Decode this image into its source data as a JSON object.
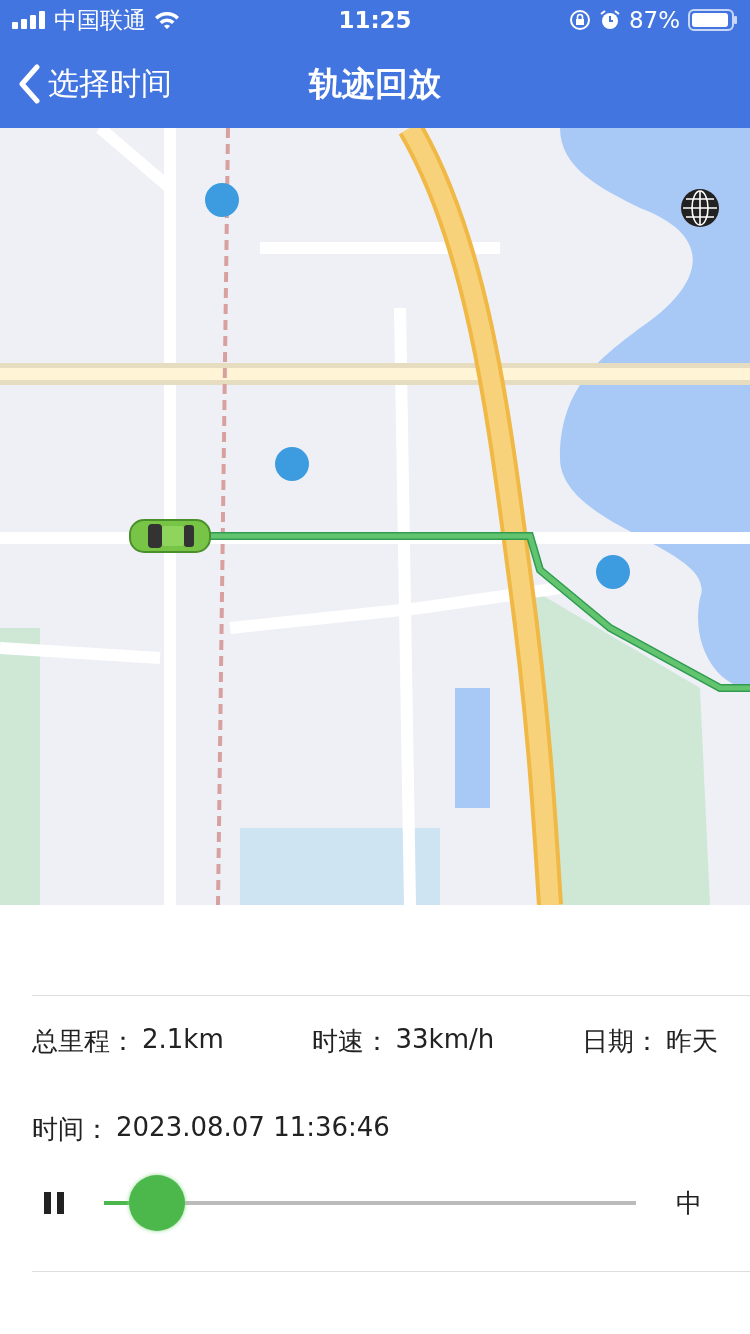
{
  "status_bar": {
    "carrier": "中国联通",
    "time": "11:25",
    "battery": "87%"
  },
  "nav": {
    "back": "选择时间",
    "title": "轨迹回放"
  },
  "stats": [
    {
      "label": "总里程：",
      "value": "2.1km"
    },
    {
      "label": "时速：",
      "value": "33km/h"
    },
    {
      "label": "日期：",
      "value": "昨天"
    }
  ],
  "time": {
    "label": "时间：",
    "value": "2023.08.07 11:36:46"
  },
  "playback": {
    "playing": true,
    "level": 0.1,
    "speed": "中"
  }
}
